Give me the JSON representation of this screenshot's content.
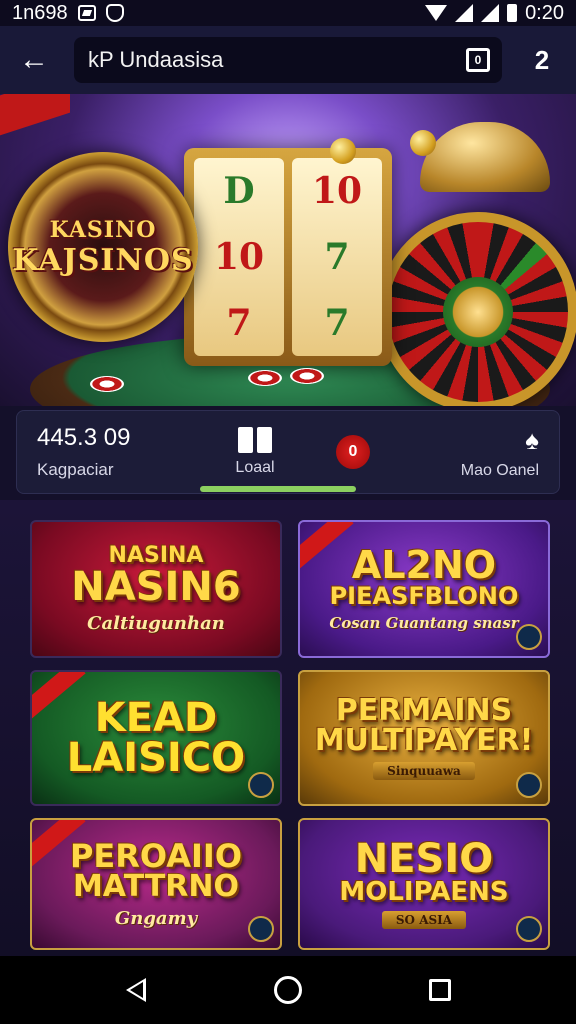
{
  "status_bar": {
    "left_text": "1n698",
    "time": "0:20"
  },
  "app_bar": {
    "url": "kP Undaasisa",
    "tab_count": "0",
    "menu_label": "2"
  },
  "hero": {
    "wheel_line1": "KASINO",
    "wheel_line2": "KAJSINOS",
    "reel_symbols": [
      [
        "D",
        "10",
        "7"
      ],
      [
        "10",
        "7",
        "7"
      ]
    ]
  },
  "info": {
    "balance_value": "445.3 09",
    "balance_label": "Kagpaciar",
    "load_label": "Loaal",
    "record_glyph": "0",
    "more_icon": "♠",
    "more_label": "Mao Oanel"
  },
  "games": [
    {
      "title": "NASINA",
      "title2": "NASIN6",
      "sub": "Caltiugunhan"
    },
    {
      "title": "AL2NO",
      "title2": "PIEASFBLONO",
      "sub": "Cosan Guantang snasr"
    },
    {
      "title": "KEAD",
      "title2": "LAISICO",
      "sub": ""
    },
    {
      "title": "PERMAINS",
      "title2": "MULTIPAYER!",
      "sub": "Sinquuawa"
    },
    {
      "title": "PEROAIIO",
      "title2": "MATTRNO",
      "sub": "Gngamy"
    },
    {
      "title": "NESIO",
      "title2": "MOLIPAENS",
      "sub": "SO ASIA"
    }
  ],
  "nav": {
    "back_icon": "back-icon",
    "home_icon": "home-icon",
    "recents_icon": "recents-icon"
  },
  "colors": {
    "background": "#14102a",
    "app_bar": "#191938",
    "accent_green": "#8cd060",
    "gold": "#ffd848"
  }
}
